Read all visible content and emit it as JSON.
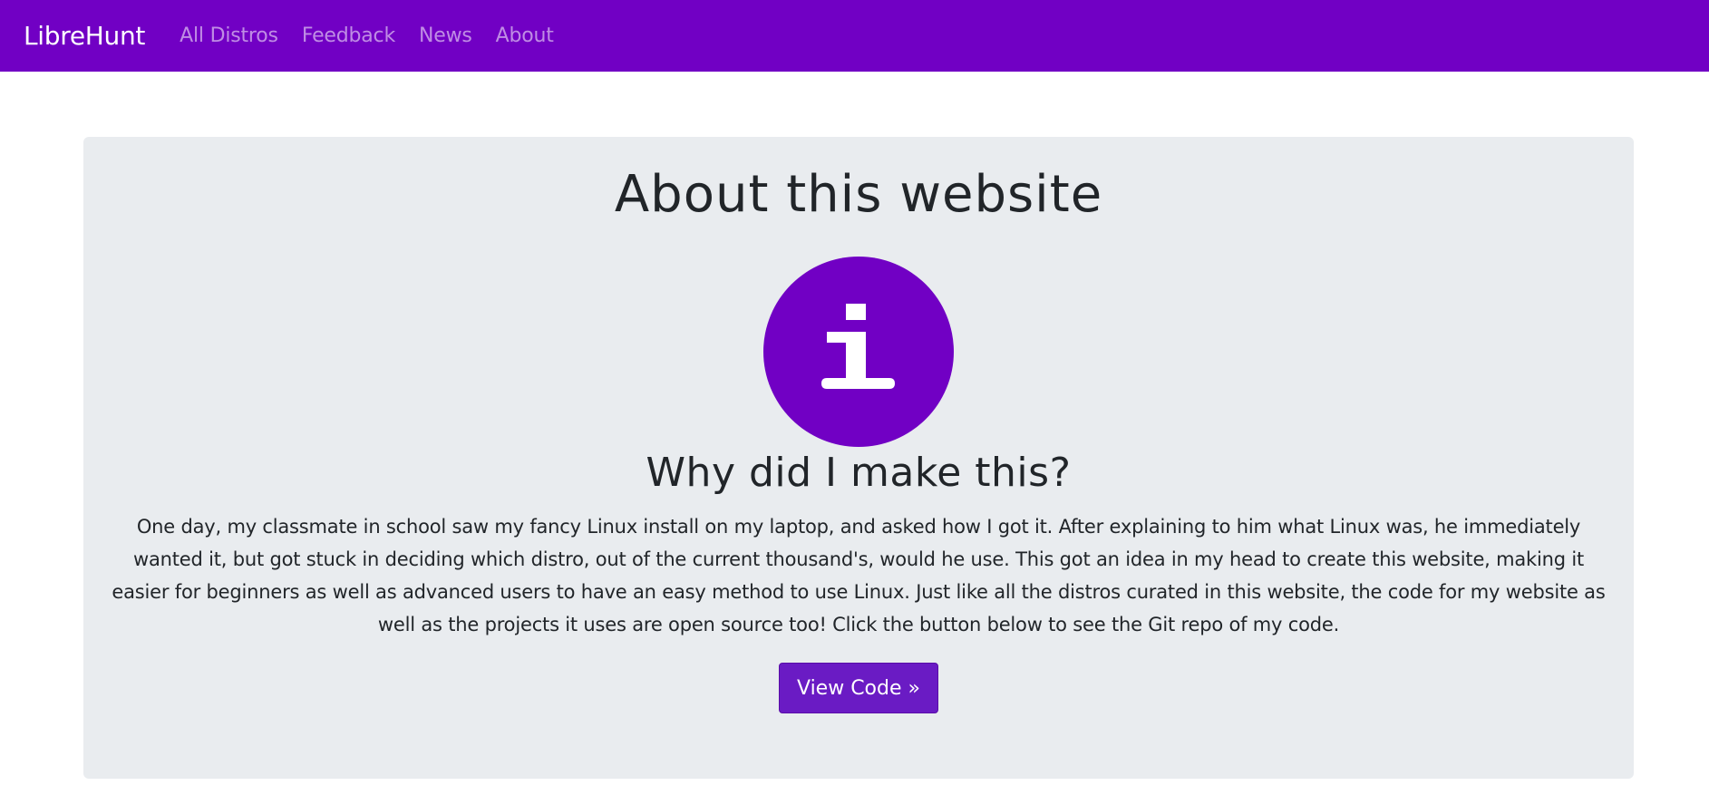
{
  "navbar": {
    "brand": "LibreHunt",
    "links": [
      {
        "label": "All Distros"
      },
      {
        "label": "Feedback"
      },
      {
        "label": "News"
      },
      {
        "label": "About"
      }
    ],
    "background_color": "#7100c4"
  },
  "main": {
    "title": "About this website",
    "icon": "info-icon",
    "subtitle": "Why did I make this?",
    "body": "One day, my classmate in school saw my fancy Linux install on my laptop, and asked how I got it. After explaining to him what Linux was, he immediately wanted it, but got stuck in deciding which distro, out of the current thousand's, would he use. This got an idea in my head to create this website, making it easier for beginners as well as advanced users to have an easy method to use Linux. Just like all the distros curated in this website, the code for my website as well as the projects it uses are open source too! Click the button below to see the Git repo of my code.",
    "button_label": "View Code »",
    "accent_color": "#7100c4",
    "panel_color": "#e9ecef"
  }
}
